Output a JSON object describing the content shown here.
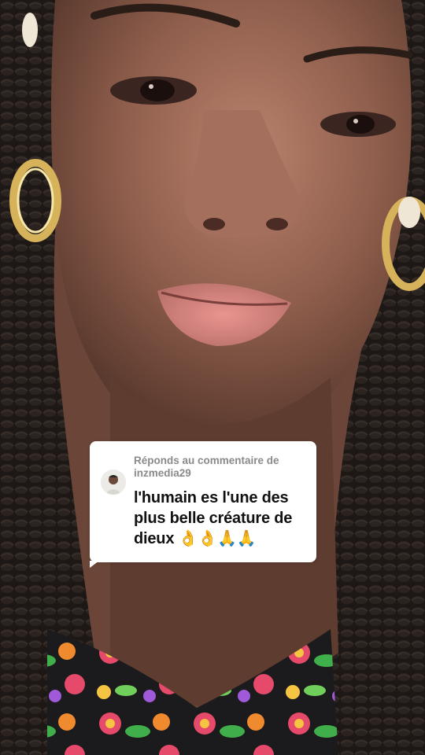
{
  "reply": {
    "label": "Réponds au commentaire de",
    "username": "inzmedia29",
    "comment": "l'humain es l'une des plus belle créature de dieux 👌👌🙏🙏"
  },
  "icons": {
    "avatar": "user-avatar-icon"
  },
  "colors": {
    "card_background": "#ffffff",
    "header_text": "#8a8a8a",
    "comment_text": "#111111"
  }
}
